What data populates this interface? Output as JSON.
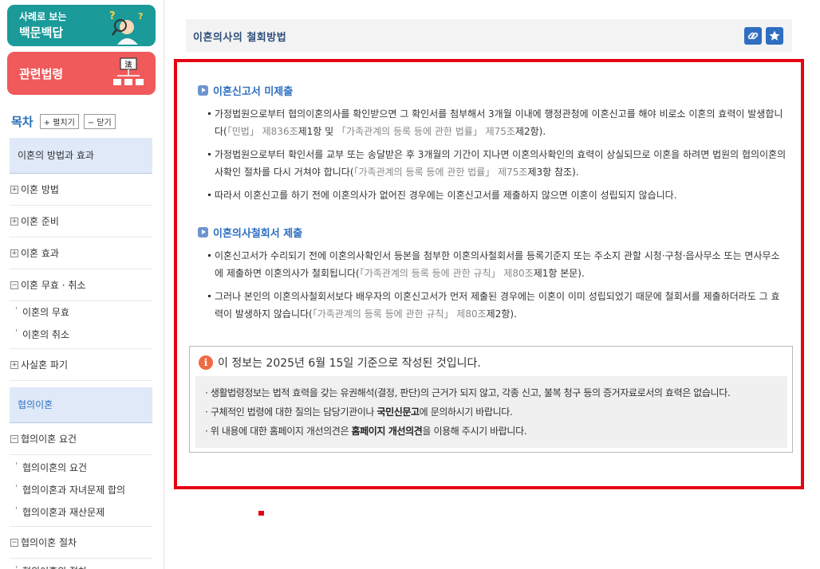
{
  "sidebar": {
    "banner_qna": {
      "small": "사례로 보는",
      "big": "백문백답"
    },
    "banner_law": {
      "label": "관련법령",
      "glyph": "法"
    },
    "toc": {
      "title": "목차",
      "expand_label": "+ 펼치기",
      "collapse_label": "− 닫기",
      "cat1": "이혼의 방법과 효과",
      "item_method": "이혼 방법",
      "item_prepare": "이혼 준비",
      "item_effect": "이혼 효과",
      "item_void": "이혼 무효 · 취소",
      "sub_void": "이혼의 무효",
      "sub_cancel": "이혼의 취소",
      "item_defacto": "사실혼 파기",
      "cat2": "협의이혼",
      "item_req": "협의이혼 요건",
      "sub_req": "협의이혼의 요건",
      "sub_child": "협의이혼과 자녀문제 합의",
      "sub_property": "협의이혼과 재산문제",
      "item_proc": "협의이혼 절차",
      "sub_proc": "협의이혼의 절차"
    }
  },
  "main": {
    "title": "이혼의사의 철회방법",
    "section1": {
      "heading": "이혼신고서 미제출",
      "b1_text": "가정법원으로부터 협의이혼의사를 확인받으면 그 확인서를 첨부해서 3개월 이내에 행정관청에 이혼신고를 해야 비로소 이혼의 효력이 발생합니다(",
      "b1_ref1": "「민법」 제836조",
      "b1_mid1": "제1항 및 ",
      "b1_ref2": "「가족관계의 등록 등에 관한 법률」 제75조",
      "b1_end": "제2항).",
      "b2_text": "가정법원으로부터 확인서를 교부 또는 송달받은 후 3개월의 기간이 지나면 이혼의사확인의 효력이 상실되므로 이혼을 하려면 법원의 협의이혼의사확인 절차를 다시 거쳐야 합니다(",
      "b2_ref": "「가족관계의 등록 등에 관한 법률」 제75조",
      "b2_end": "제3항 참조).",
      "b3_text": "따라서 이혼신고를 하기 전에 이혼의사가 없어진 경우에는 이혼신고서를 제출하지 않으면 이혼이 성립되지 않습니다."
    },
    "section2": {
      "heading": "이혼의사철회서 제출",
      "b1_text": "이혼신고서가 수리되기 전에 이혼의사확인서 등본을 첨부한 이혼의사철회서를 등록기준지 또는 주소지 관할 시청·구청·읍사무소 또는 면사무소에 제출하면 이혼의사가 철회됩니다(",
      "b1_ref": "「가족관계의 등록 등에 관한 규칙」 제80조",
      "b1_end": "제1항 본문).",
      "b2_text": "그러나 본인의 이혼의사철회서보다 배우자의 이혼신고서가 먼저 제출된 경우에는 이혼이 이미 성립되었기 때문에 철회서를 제출하더라도 그 효력이 발생하지 않습니다(",
      "b2_ref": "「가족관계의 등록 등에 관한 규칙」 제80조",
      "b2_end": "제2항)."
    },
    "notice": {
      "icon": "i",
      "heading": "이 정보는 2025년 6월 15일 기준으로 작성된 것입니다.",
      "line1": "· 생활법령정보는 법적 효력을 갖는 유권해석(결정, 판단)의 근거가 되지 않고, 각종 신고, 불복 청구 등의 증거자료로서의 효력은 없습니다.",
      "line2_pre": "· 구체적인 법령에 대한 질의는 담당기관이나 ",
      "line2_bold": "국민신문고",
      "line2_post": "에 문의하시기 바랍니다.",
      "line3_pre": "· 위 내용에 대한 홈페이지 개선의견은 ",
      "line3_bold": "홈페이지 개선의견",
      "line3_post": "을 이용해 주시기 바랍니다."
    }
  },
  "colors": {
    "accent": "#2f6ec1",
    "highlight_border": "#e60012",
    "teal_banner": "#1b9a9a",
    "red_banner": "#f05a5a"
  }
}
